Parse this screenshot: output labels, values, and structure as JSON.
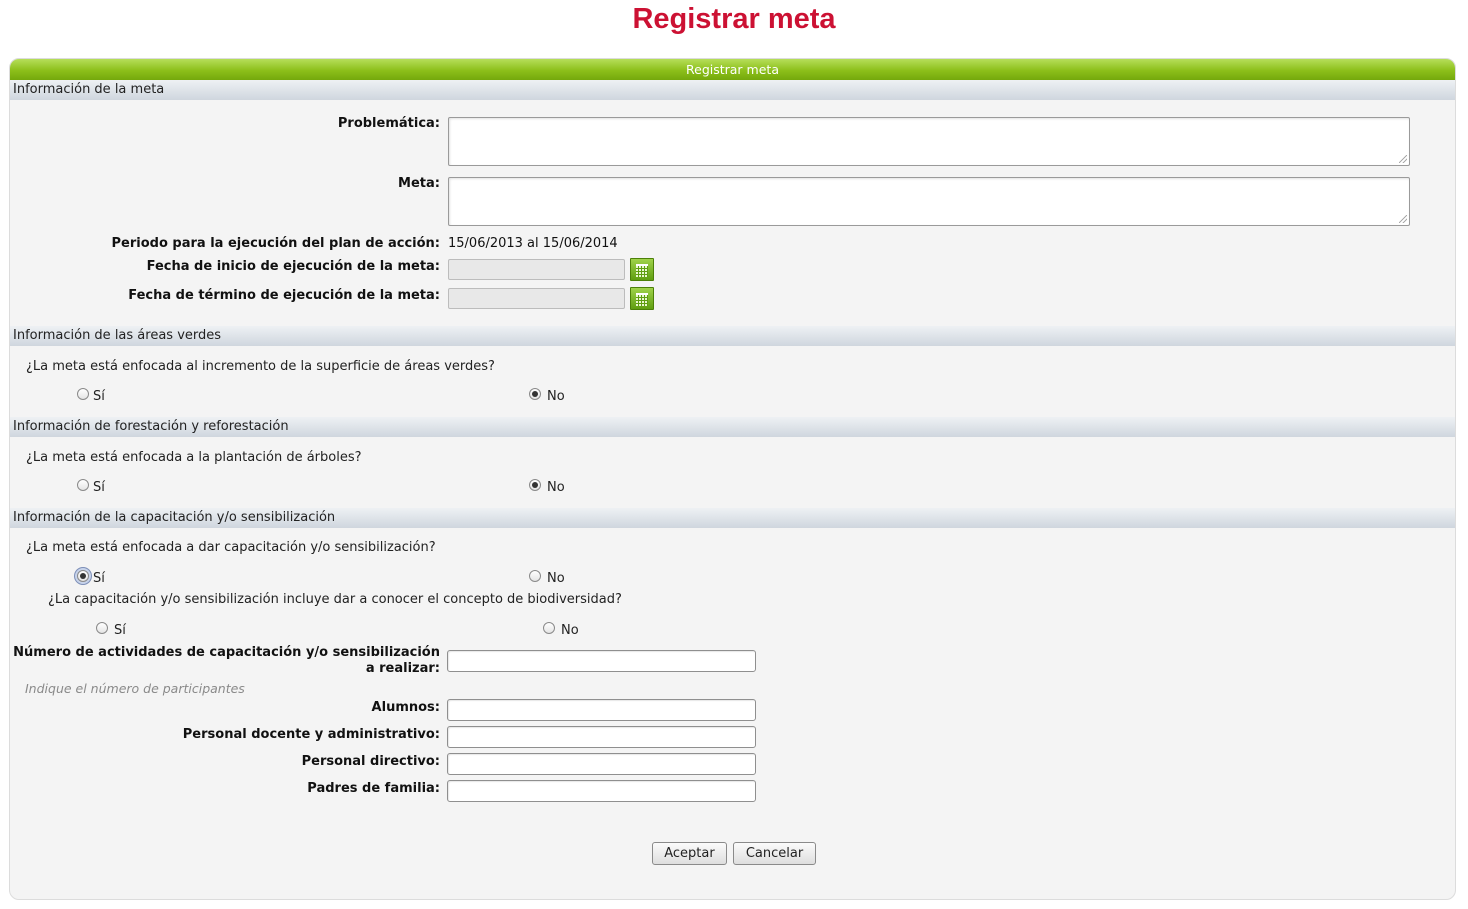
{
  "page": {
    "title": "Registrar meta"
  },
  "panel": {
    "header": "Registrar meta"
  },
  "sections": {
    "meta": {
      "title": "Información de la meta",
      "problematica_label": "Problemática:",
      "problematica_value": "",
      "meta_label": "Meta:",
      "meta_value": "",
      "periodo_label": "Periodo para la ejecución del plan de acción:",
      "periodo_value": "15/06/2013 al 15/06/2014",
      "fecha_inicio_label": "Fecha de inicio de ejecución de la meta:",
      "fecha_inicio_value": "",
      "fecha_termino_label": "Fecha de término de ejecución de la meta:",
      "fecha_termino_value": "",
      "calendar_icon": "calendar-icon"
    },
    "areas_verdes": {
      "title": "Información de las áreas verdes",
      "question": "¿La meta está enfocada al incremento de la superficie de áreas verdes?",
      "yes_label": "Sí",
      "no_label": "No",
      "selected": "No"
    },
    "forestacion": {
      "title": "Información de forestación y reforestación",
      "question": "¿La meta está enfocada a la plantación de árboles?",
      "yes_label": "Sí",
      "no_label": "No",
      "selected": "No"
    },
    "capacitacion": {
      "title": "Información de la capacitación y/o sensibilización",
      "question": "¿La meta está enfocada a dar capacitación y/o sensibilización?",
      "yes_label": "Sí",
      "no_label": "No",
      "selected": "Sí",
      "sub_question": "¿La capacitación y/o sensibilización incluye dar a conocer el concepto de biodiversidad?",
      "sub_yes_label": "Sí",
      "sub_no_label": "No",
      "sub_selected": "",
      "num_actividades_label": "Número de actividades de capacitación y/o sensibilización a realizar:",
      "num_actividades_value": "",
      "participantes_hint": "Indique el número de participantes",
      "alumnos_label": "Alumnos:",
      "alumnos_value": "",
      "docente_label": "Personal docente y administrativo:",
      "docente_value": "",
      "directivo_label": "Personal directivo:",
      "directivo_value": "",
      "padres_label": "Padres de familia:",
      "padres_value": ""
    }
  },
  "buttons": {
    "accept": "Aceptar",
    "cancel": "Cancelar"
  },
  "colors": {
    "title": "#cc1133",
    "header_green": "#8cbf1a",
    "section_bar": "#cfd6de"
  }
}
